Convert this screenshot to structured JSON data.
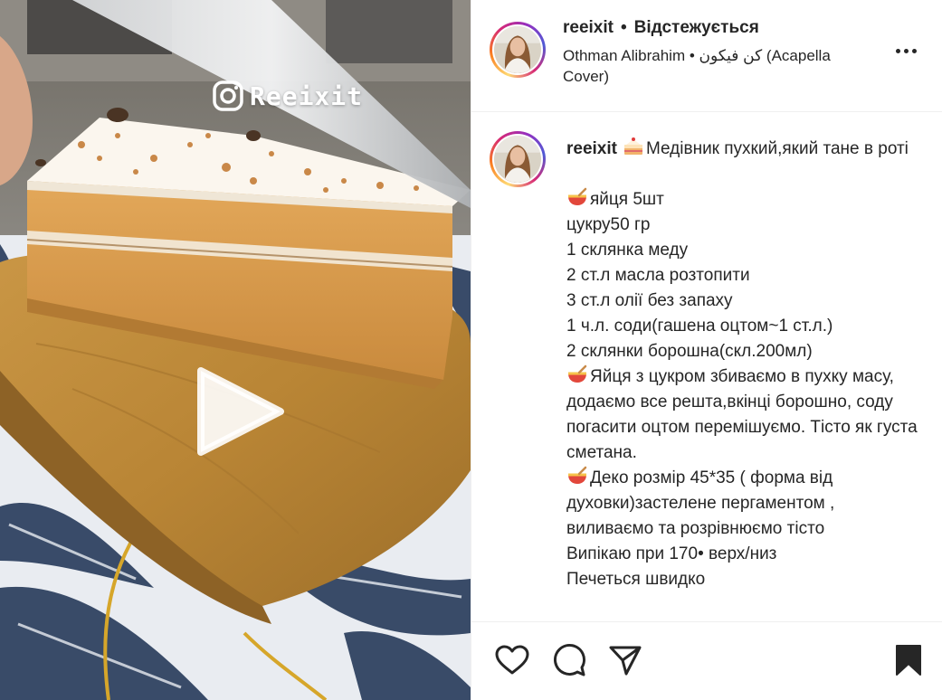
{
  "media": {
    "watermark_text": "Reeixit",
    "play_icon": "play-icon",
    "watermark_icon": "instagram-icon"
  },
  "header": {
    "username": "reeixit",
    "separator": "•",
    "follow_state": "Відстежується",
    "audio": "Othman Alibrahim • كن فيكون (Acapella Cover)",
    "more_icon": "more-horizontal-icon"
  },
  "caption": {
    "username": "reeixit",
    "lines": [
      {
        "emoji": "cake-emoji",
        "text": "Медівник пухкий,який тане в роті"
      },
      {
        "emoji": "",
        "text": ""
      },
      {
        "emoji": "bowl-emoji",
        "text": "яйця 5шт"
      },
      {
        "emoji": "",
        "text": "цукру50 гр"
      },
      {
        "emoji": "",
        "text": "1 склянка меду"
      },
      {
        "emoji": "",
        "text": "2 ст.л масла розтопити"
      },
      {
        "emoji": "",
        "text": "3 ст.л олії без запаху"
      },
      {
        "emoji": "",
        "text": "1 ч.л. соди(гашена оцтом~1 ст.л.)"
      },
      {
        "emoji": "",
        "text": "2 склянки борошна(скл.200мл)"
      },
      {
        "emoji": "bowl-emoji",
        "text": "Яйця з цукром збиваємо в пухку масу, додаємо все решта,вкінці борошно, соду погасити оцтом перемішуємо. Тісто як густа сметана."
      },
      {
        "emoji": "bowl-emoji",
        "text": "Деко розмір 45*35 ( форма від духовки)застелене пергаментом , виливаємо та розрівнюємо тісто"
      },
      {
        "emoji": "",
        "text": "Випікаю при 170• верх/низ"
      },
      {
        "emoji": "",
        "text": "Печеться швидко"
      }
    ]
  },
  "actions": {
    "like_icon": "heart-icon",
    "comment_icon": "comment-icon",
    "share_icon": "send-icon",
    "save_icon": "bookmark-icon"
  }
}
